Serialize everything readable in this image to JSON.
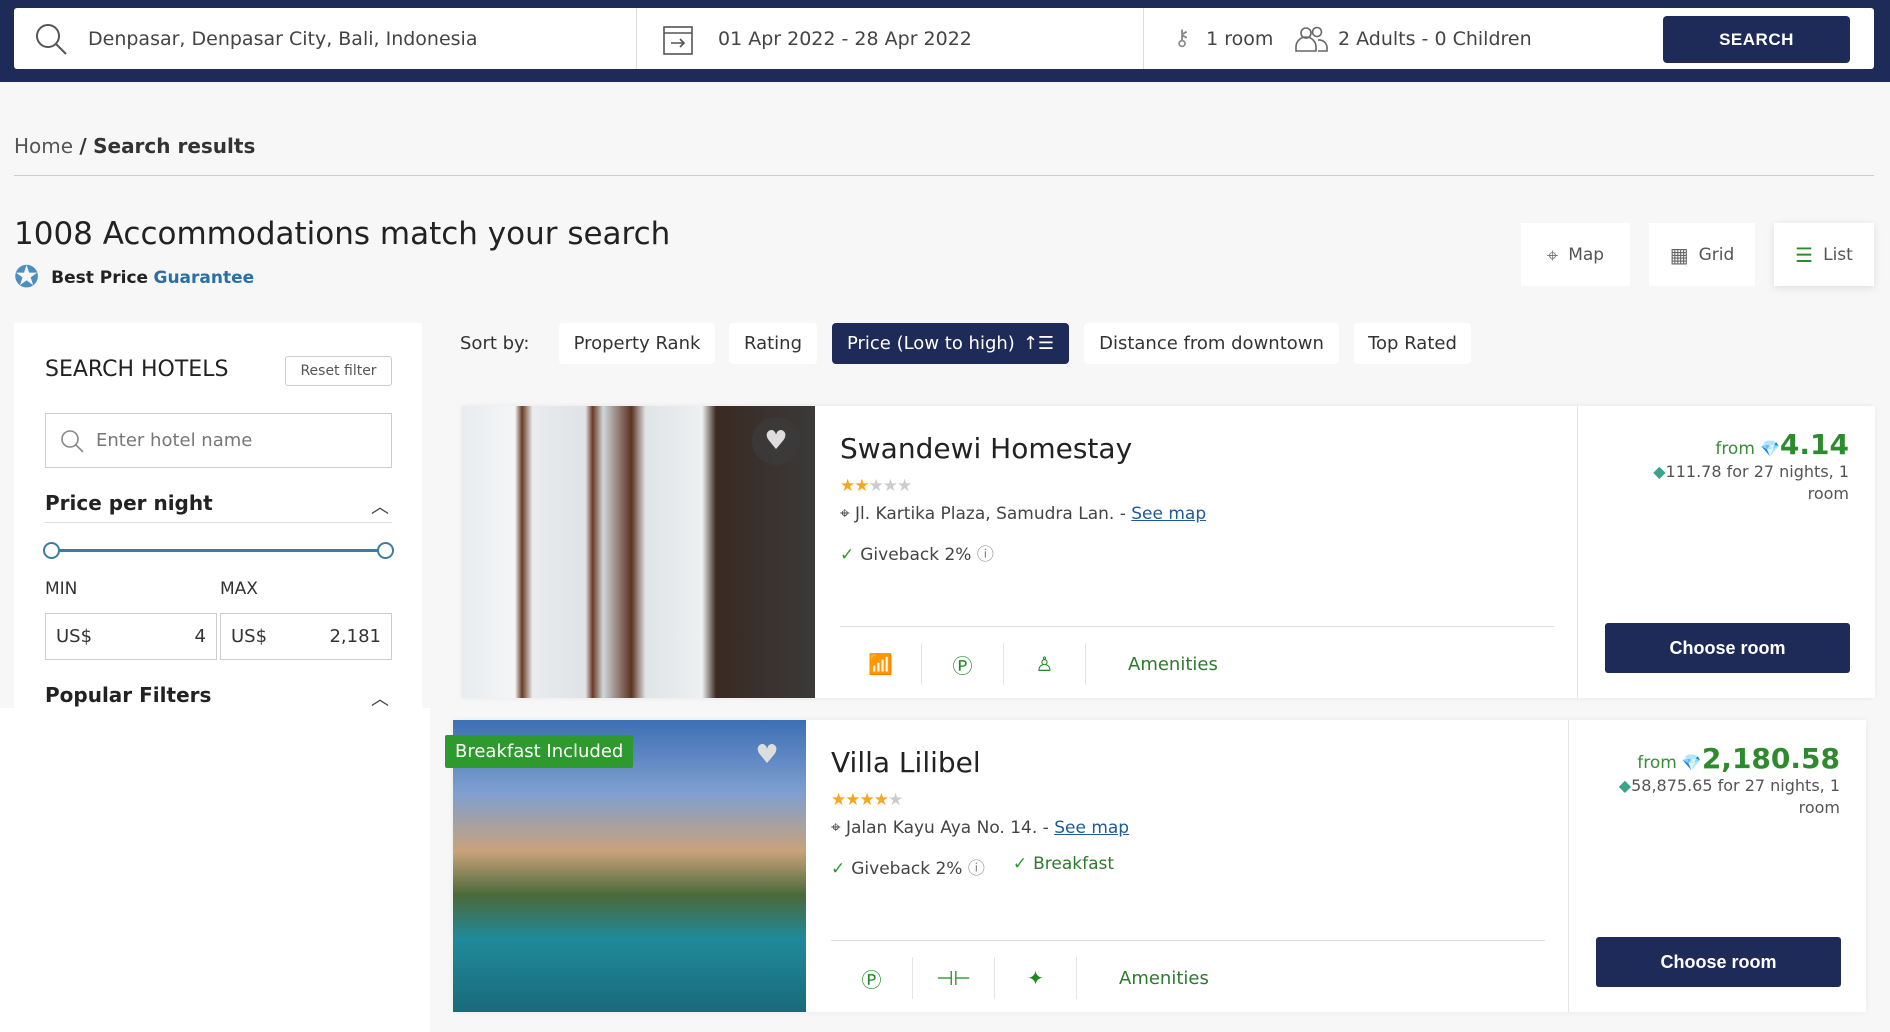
{
  "search": {
    "location": "Denpasar, Denpasar City, Bali, Indonesia",
    "dates": "01 Apr 2022 - 28 Apr 2022",
    "rooms": "1 room",
    "guests": "2 Adults - 0 Children",
    "button": "SEARCH"
  },
  "breadcrumb": {
    "home": "Home",
    "sep": "/",
    "current": "Search results"
  },
  "header": {
    "title": "1008 Accommodations match your search",
    "best_price": "Best Price",
    "guarantee": "Guarantee"
  },
  "views": {
    "map": "Map",
    "grid": "Grid",
    "list": "List"
  },
  "sidebar": {
    "title": "SEARCH HOTELS",
    "reset": "Reset filter",
    "hotel_placeholder": "Enter hotel name",
    "price_title": "Price per night",
    "min_label": "MIN",
    "max_label": "MAX",
    "currency": "US$",
    "min_value": "4",
    "max_value": "2,181",
    "popular": "Popular Filters"
  },
  "sort": {
    "label": "Sort by:",
    "options": [
      "Property Rank",
      "Rating",
      "Price (Low to high)",
      "Distance from downtown",
      "Top Rated"
    ],
    "active": 2
  },
  "hotels": [
    {
      "name": "Swandewi Homestay",
      "stars": 2,
      "address": "Jl. Kartika Plaza, Samudra Lan. -",
      "see_map": "See map",
      "giveback": "Giveback 2%",
      "from": "from",
      "price": "4.14",
      "total": "111.78",
      "total_suffix": "for 27 nights, 1 room",
      "amenities": "Amenities",
      "choose": "Choose room"
    },
    {
      "name": "Villa Lilibel",
      "badge": "Breakfast Included",
      "stars": 4,
      "address": "Jalan Kayu Aya No. 14. -",
      "see_map": "See map",
      "giveback": "Giveback 2%",
      "breakfast": "Breakfast",
      "from": "from",
      "price": "2,180.58",
      "total": "58,875.65",
      "total_suffix": "for 27 nights, 1 room",
      "amenities": "Amenities",
      "choose": "Choose room"
    }
  ],
  "colors": {
    "navy": "#1e2a57",
    "green": "#2d8a2d",
    "star": "#f5a623",
    "link": "#1e5a99"
  }
}
